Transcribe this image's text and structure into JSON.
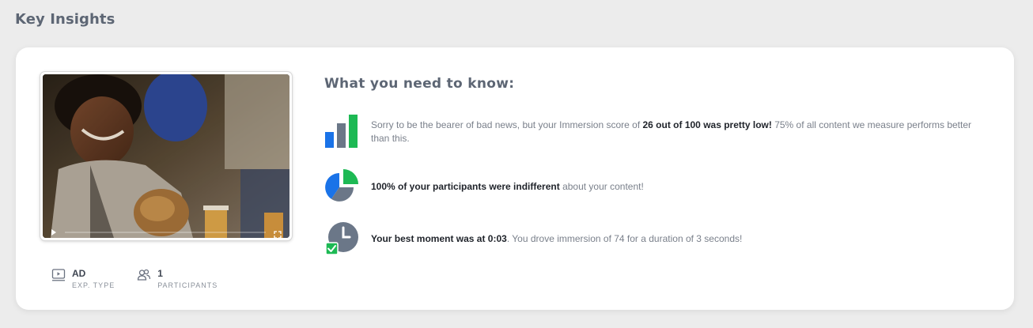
{
  "section_title": "Key Insights",
  "video": {
    "play_icon": "play-icon",
    "fullscreen_icon": "fullscreen-icon"
  },
  "meta": {
    "exp_type": {
      "value": "AD",
      "label": "EXP. TYPE",
      "icon": "video-screen-icon"
    },
    "participants": {
      "value": "1",
      "label": "PARTICIPANTS",
      "icon": "people-icon"
    }
  },
  "insights": {
    "heading": "What you need to know:",
    "items": [
      {
        "icon": "bar-chart-icon",
        "pre": "Sorry to be the bearer of bad news, but your Immersion score of ",
        "bold": "26 out of 100 was pretty low!",
        "post": " 75% of all content we measure performs better than this."
      },
      {
        "icon": "pie-chart-icon",
        "pre": "",
        "bold": "100% of your participants were indifferent",
        "post": " about your content!"
      },
      {
        "icon": "clock-check-icon",
        "pre": "",
        "bold": "Your best moment was at 0:03",
        "post": ". You drove immersion of 74 for a duration of 3 seconds!"
      }
    ]
  },
  "colors": {
    "blue": "#1a73e8",
    "green": "#1db954",
    "slate": "#6b7788"
  }
}
